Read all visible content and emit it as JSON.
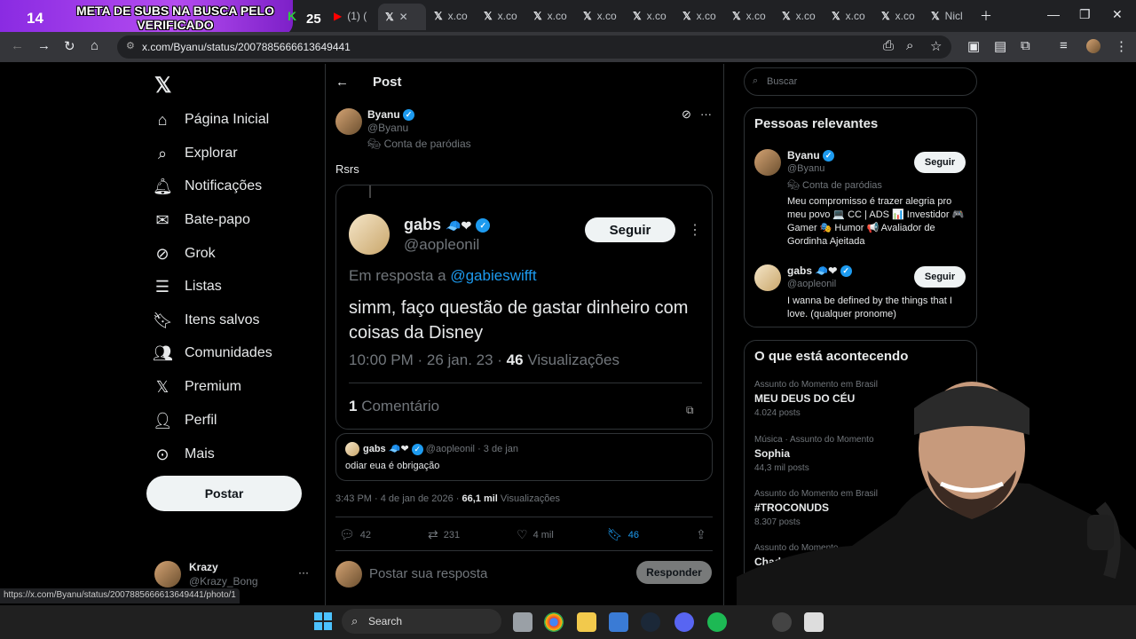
{
  "overlay": {
    "count": "14",
    "text": "META DE SUBS NA BUSCA PELO VERIFICADO",
    "k": "K",
    "n": "25"
  },
  "tabs": {
    "t1": "(1) (",
    "tab_label": "x.co",
    "last": "Nicl"
  },
  "browser": {
    "url": "x.com/Byanu/status/2007885666613649441",
    "status_url": "https://x.com/Byanu/status/2007885666613649441/photo/1"
  },
  "sidebar": {
    "items": [
      "Página Inicial",
      "Explorar",
      "Notificações",
      "Bate-papo",
      "Grok",
      "Listas",
      "Itens salvos",
      "Comunidades",
      "Premium",
      "Perfil",
      "Mais"
    ],
    "post_button": "Postar",
    "account_name": "Krazy",
    "account_handle": "@Krazy_Bong",
    "more": "···"
  },
  "post": {
    "header": "Post",
    "author_name": "Byanu",
    "author_handle": "@Byanu",
    "parody_label": "Conta de paródias",
    "text": "Rsrs",
    "embed": {
      "name": "gabs",
      "handle": "@aopleonil",
      "follow": "Seguir",
      "reply_prefix": "Em resposta a",
      "reply_to": "@gabieswifft",
      "text": "simm, faço questão de gastar dinheiro com coisas da Disney",
      "meta": "10:00 PM · 26 jan. 23 ·",
      "views": "46",
      "views_label": "Visualizações",
      "comments_count": "1",
      "comments_label": "Comentário"
    },
    "quote": {
      "name": "gabs",
      "handle": "@aopleonil",
      "date": "· 3 de jan",
      "text": "odiar eua é obrigação"
    },
    "meta": "3:43 PM · 4 de jan de 2026 ·",
    "views": "66,1 mil",
    "views_label": "Visualizações",
    "actions": {
      "replies": "42",
      "reposts": "231",
      "likes": "4 mil",
      "bookmarks": "46"
    },
    "reply_placeholder": "Postar sua resposta",
    "reply_button": "Responder"
  },
  "right": {
    "search_placeholder": "Buscar",
    "relevant_title": "Pessoas relevantes",
    "people": [
      {
        "name": "Byanu",
        "handle": "@Byanu",
        "parody": "Conta de paródias",
        "bio": "Meu compromisso é trazer alegria pro meu povo 💻 CC | ADS 📊 Investidor 🎮 Gamer 🎭 Humor 📢 Avaliador de Gordinha Ajeitada",
        "follow": "Seguir"
      },
      {
        "name": "gabs",
        "handle": "@aopleonil",
        "bio": "I wanna be defined by the things that I love. (qualquer pronome)",
        "follow": "Seguir"
      }
    ],
    "trending_title": "O que está acontecendo",
    "trends": [
      {
        "context": "Assunto do Momento em Brasil",
        "topic": "MEU DEUS DO CÉU",
        "posts": "4.024 posts"
      },
      {
        "context": "Música · Assunto do Momento",
        "topic": "Sophia",
        "posts": "44,3 mil posts"
      },
      {
        "context": "Assunto do Momento em Brasil",
        "topic": "#TROCONUDS",
        "posts": "8.307 posts"
      },
      {
        "context": "Assunto do Momento",
        "topic": "Chad",
        "posts": ""
      }
    ]
  },
  "taskbar": {
    "search": "Search"
  },
  "colors": {
    "accent": "#1d9bf0",
    "overlay": "#8a2be2"
  }
}
